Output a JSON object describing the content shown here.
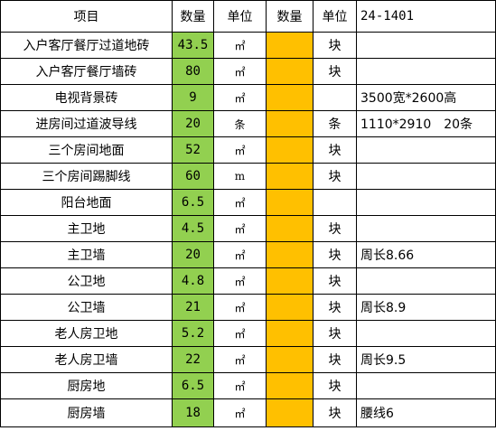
{
  "header": {
    "col_item": "项目",
    "col_qty": "数量",
    "col_unit": "单位",
    "col_qty2": "数量",
    "col_unit2": "单位",
    "col_note": "24-1401"
  },
  "colors": {
    "qty_bg": "#92d050",
    "qty2_bg": "#ffc000",
    "border": "#000000"
  },
  "rows": [
    {
      "name": "入户客厅餐厅过道地砖",
      "qty": "43.5",
      "unit": "㎡",
      "qty2": "",
      "unit2": "块",
      "note": ""
    },
    {
      "name": "入户客厅餐厅墙砖",
      "qty": "80",
      "unit": "㎡",
      "qty2": "",
      "unit2": "块",
      "note": ""
    },
    {
      "name": "电视背景砖",
      "qty": "9",
      "unit": "㎡",
      "qty2": "",
      "unit2": "",
      "note": "3500宽*2600高"
    },
    {
      "name": "进房间过道波导线",
      "qty": "20",
      "unit": "条",
      "qty2": "",
      "unit2": "条",
      "note": "1110*2910　20条"
    },
    {
      "name": "三个房间地面",
      "qty": "52",
      "unit": "㎡",
      "qty2": "",
      "unit2": "块",
      "note": ""
    },
    {
      "name": "三个房间踢脚线",
      "qty": "60",
      "unit": "m",
      "qty2": "",
      "unit2": "块",
      "note": ""
    },
    {
      "name": "阳台地面",
      "qty": "6.5",
      "unit": "㎡",
      "qty2": "",
      "unit2": "",
      "note": ""
    },
    {
      "name": "主卫地",
      "qty": "4.5",
      "unit": "㎡",
      "qty2": "",
      "unit2": "块",
      "note": ""
    },
    {
      "name": "主卫墙",
      "qty": "20",
      "unit": "㎡",
      "qty2": "",
      "unit2": "块",
      "note": "周长8.66"
    },
    {
      "name": "公卫地",
      "qty": "4.8",
      "unit": "㎡",
      "qty2": "",
      "unit2": "块",
      "note": ""
    },
    {
      "name": "公卫墙",
      "qty": "21",
      "unit": "㎡",
      "qty2": "",
      "unit2": "块",
      "note": "周长8.9"
    },
    {
      "name": "老人房卫地",
      "qty": "5.2",
      "unit": "㎡",
      "qty2": "",
      "unit2": "块",
      "note": ""
    },
    {
      "name": "老人房卫墙",
      "qty": "22",
      "unit": "㎡",
      "qty2": "",
      "unit2": "块",
      "note": "周长9.5"
    },
    {
      "name": "厨房地",
      "qty": "6.5",
      "unit": "㎡",
      "qty2": "",
      "unit2": "块",
      "note": ""
    },
    {
      "name": "厨房墙",
      "qty": "18",
      "unit": "㎡",
      "qty2": "",
      "unit2": "块",
      "note": "腰线6"
    }
  ]
}
